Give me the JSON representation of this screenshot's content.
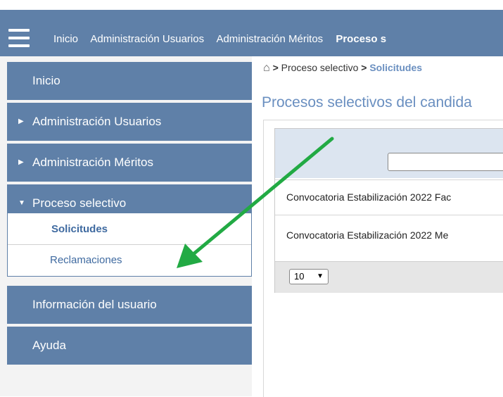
{
  "nav": {
    "links": [
      "Inicio",
      "Administración Usuarios",
      "Administración Méritos",
      "Proceso s"
    ]
  },
  "sidebar": {
    "items": [
      {
        "label": "Inicio",
        "icon": ""
      },
      {
        "label": "Administración Usuarios",
        "icon": "triangle-right-icon"
      },
      {
        "label": "Administración Méritos",
        "icon": "triangle-right-icon"
      },
      {
        "label": "Proceso selectivo",
        "icon": "triangle-down-icon"
      },
      {
        "label": "Información del usuario",
        "icon": ""
      },
      {
        "label": "Ayuda",
        "icon": ""
      }
    ],
    "submenu": [
      "Solicitudes",
      "Reclamaciones"
    ]
  },
  "breadcrumb": {
    "icon": "home-icon",
    "home_glyph": "⌂",
    "sep": ">",
    "item1": "Proceso selectivo",
    "current": "Solicitudes"
  },
  "main": {
    "title": "Procesos selectivos del candida",
    "rows": [
      "Convocatoria Estabilización 2022 Fac",
      "Convocatoria Estabilización 2022 Me"
    ],
    "page_size": "10"
  },
  "colors": {
    "navbar": "#5f80a8",
    "accent_text": "#6a8fc0",
    "annotation_arrow": "#22aa44"
  }
}
